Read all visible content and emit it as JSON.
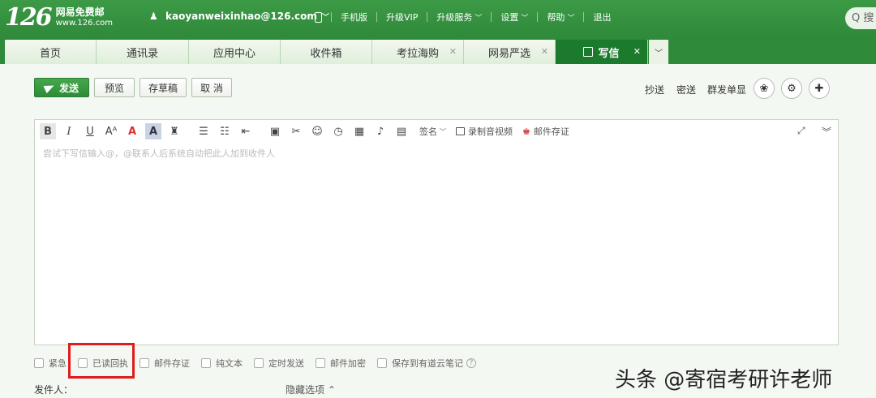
{
  "header": {
    "logo_number": "126",
    "logo_name": "网易免费邮",
    "logo_url": "www.126.com",
    "account_email": "kaoyanweixinhao@126.com",
    "links": [
      "手机版",
      "升级VIP",
      "升级服务",
      "设置",
      "帮助",
      "退出"
    ],
    "search_placeholder": "Q 搜"
  },
  "tabs": [
    {
      "label": "首页",
      "closable": false,
      "active": false
    },
    {
      "label": "通讯录",
      "closable": false,
      "active": false
    },
    {
      "label": "应用中心",
      "closable": false,
      "active": false
    },
    {
      "label": "收件箱",
      "closable": false,
      "active": false
    },
    {
      "label": "考拉海购",
      "closable": true,
      "active": false
    },
    {
      "label": "网易严选",
      "closable": true,
      "active": false
    },
    {
      "label": "写信",
      "closable": true,
      "active": true
    }
  ],
  "toolbar": {
    "send": "发送",
    "preview": "预览",
    "save_draft": "存草稿",
    "cancel": "取 消",
    "cc": "抄送",
    "bcc": "密送",
    "separate_send": "群发单显"
  },
  "editor": {
    "signature": "签名",
    "record_video": "录制音视频",
    "mail_evidence": "邮件存证",
    "placeholder": "尝试下写信输入@，@联系人后系统自动把此人加到收件人"
  },
  "options": [
    "紧急",
    "已读回执",
    "邮件存证",
    "纯文本",
    "定时发送",
    "邮件加密",
    "保存到有道云笔记"
  ],
  "footer": {
    "sender_label": "发件人：",
    "hide_options": "隐藏选项 ⌃"
  },
  "watermark": "头条 @寄宿考研许老师",
  "colors": {
    "header_green": "#2f8a3a",
    "active_tab": "#1b7a2c",
    "highlight_red": "#e01b1b"
  }
}
